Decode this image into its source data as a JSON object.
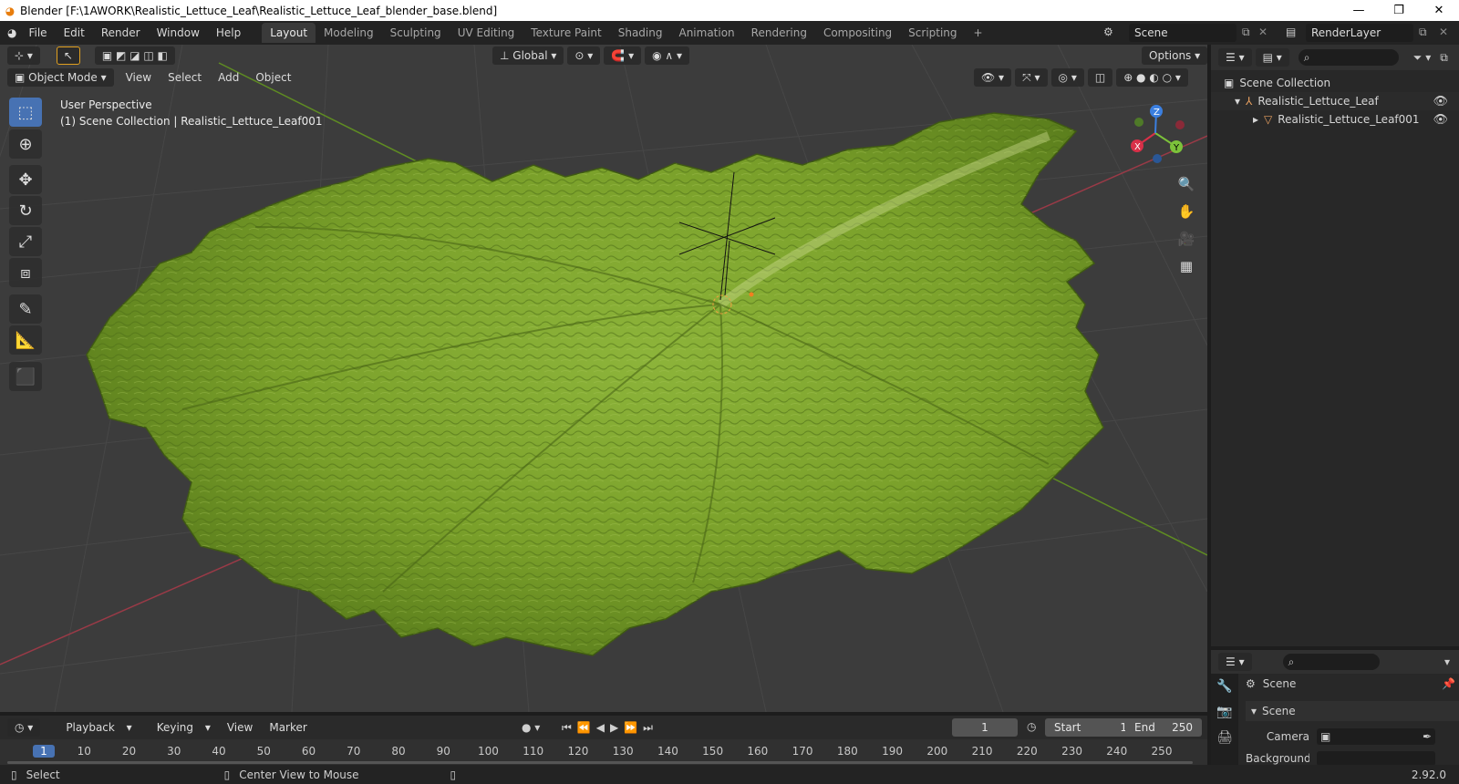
{
  "titlebar": {
    "title": "Blender [F:\\1AWORK\\Realistic_Lettuce_Leaf\\Realistic_Lettuce_Leaf_blender_base.blend]",
    "minimize": "—",
    "maximize": "❐",
    "close": "✕"
  },
  "menus": [
    "File",
    "Edit",
    "Render",
    "Window",
    "Help"
  ],
  "workspaces": [
    {
      "label": "Layout",
      "active": true
    },
    {
      "label": "Modeling"
    },
    {
      "label": "Sculpting"
    },
    {
      "label": "UV Editing"
    },
    {
      "label": "Texture Paint"
    },
    {
      "label": "Shading"
    },
    {
      "label": "Animation"
    },
    {
      "label": "Rendering"
    },
    {
      "label": "Compositing"
    },
    {
      "label": "Scripting"
    },
    {
      "label": "+"
    }
  ],
  "scene_selector": {
    "value": "Scene"
  },
  "view_layer_selector": {
    "value": "RenderLayer"
  },
  "viewport": {
    "mode": "Object Mode",
    "menu": [
      "View",
      "Select",
      "Add",
      "Object"
    ],
    "orientation": "Global",
    "options": "Options",
    "view_name": "User Perspective",
    "collection_info": "(1) Scene Collection | Realistic_Lettuce_Leaf001",
    "gizmo": {
      "x": "X",
      "y": "Y",
      "z": "Z"
    },
    "colors": {
      "x_axis": "#b04050",
      "y_axis": "#6a9a2a",
      "leaf": "#7aa02a",
      "leaf_dark": "#4f6e18"
    }
  },
  "outliner": {
    "root": "Scene Collection",
    "items": [
      {
        "label": "Realistic_Lettuce_Leaf",
        "icon": "armature-icon"
      },
      {
        "label": "Realistic_Lettuce_Leaf001",
        "icon": "mesh-icon"
      }
    ]
  },
  "properties": {
    "tab_title": "Scene",
    "section": "Scene",
    "camera_label": "Camera",
    "partial_label": "Background Sce..."
  },
  "timeline": {
    "menu": [
      "Playback",
      "Keying",
      "View",
      "Marker"
    ],
    "current_frame": "1",
    "start_label": "Start",
    "start_value": "1",
    "end_label": "End",
    "end_value": "250",
    "ruler": [
      "1",
      "10",
      "20",
      "30",
      "40",
      "50",
      "60",
      "70",
      "80",
      "90",
      "100",
      "110",
      "120",
      "130",
      "140",
      "150",
      "160",
      "170",
      "180",
      "190",
      "200",
      "210",
      "220",
      "230",
      "240",
      "250"
    ]
  },
  "statusbar": {
    "select": "Select",
    "center_view": "Center View to Mouse",
    "version": "2.92.0"
  }
}
